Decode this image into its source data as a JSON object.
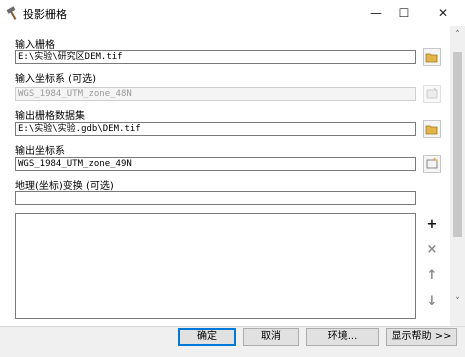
{
  "window": {
    "title": "投影栅格",
    "minimize": "—",
    "maximize": "☐",
    "close": "✕"
  },
  "form": {
    "input_raster_label": "输入栅格",
    "input_raster_value": "E:\\实验\\研究区DEM.tif",
    "input_cs_label": "输入坐标系 (可选)",
    "input_cs_value": "WGS_1984_UTM_zone_48N",
    "output_raster_label": "输出栅格数据集",
    "output_raster_value": "E:\\实验\\实验.gdb\\DEM.tif",
    "output_cs_label": "输出坐标系",
    "output_cs_value": "WGS_1984_UTM_zone_49N",
    "geo_transform_label": "地理(坐标)变换 (可选)",
    "geo_transform_value": ""
  },
  "list_buttons": {
    "add": "+",
    "remove": "×",
    "up": "↑",
    "down": "↓"
  },
  "footer": {
    "ok": "确定",
    "cancel": "取消",
    "env": "环境...",
    "help": "显示帮助 >>"
  }
}
